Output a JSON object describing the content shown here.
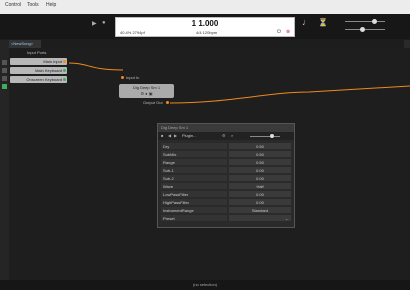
{
  "menu": {
    "control": "Control",
    "tools": "Tools",
    "help": "Help"
  },
  "transport": {
    "time": "1 1.000",
    "cpu": "40.4% 2794pf",
    "signature": "4/4 120bpm"
  },
  "breadcrumb": "<NewSong>",
  "graph": {
    "inputs_label": "Input Ports",
    "ports": [
      "Main Input",
      "Main Keyboard",
      "Onscreen Keyboard"
    ],
    "node_title": "Dig Deep Sm 1",
    "node_input_label": "Input In",
    "node_output_label": "Output Out"
  },
  "plugin": {
    "title": "Dig Deep Sm 1",
    "preset_button": "Plugin...",
    "params": [
      {
        "name": "Dry",
        "value": "0.50"
      },
      {
        "name": "SubMix",
        "value": "0.50"
      },
      {
        "name": "Range",
        "value": "0.50"
      },
      {
        "name": "Sub-1",
        "value": "0.00"
      },
      {
        "name": "Sub-2",
        "value": "0.00"
      },
      {
        "name": "Wave",
        "value": "Half"
      },
      {
        "name": "LowPassFilter",
        "value": "0.00"
      },
      {
        "name": "HighPassFilter",
        "value": "0.00"
      },
      {
        "name": "InstrumentRange",
        "value": "Standard"
      },
      {
        "name": "Preset",
        "value": ""
      }
    ]
  },
  "status": "(no selection)",
  "colors": {
    "accent_orange": "#f08a1a",
    "port_green": "#3fae5c"
  }
}
